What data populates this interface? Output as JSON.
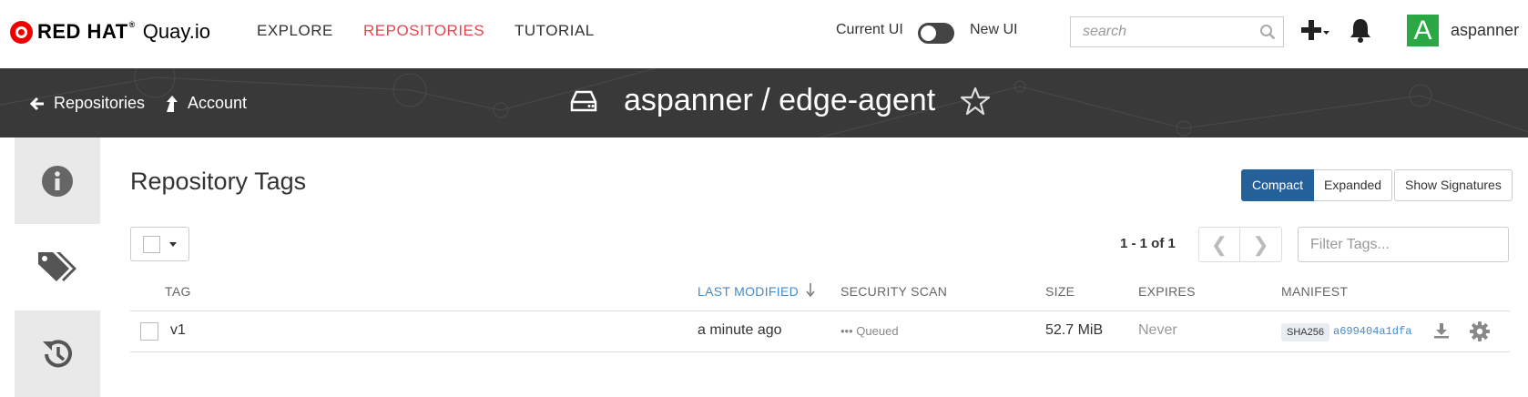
{
  "brand": {
    "red_hat": "RED HAT",
    "reg": "®",
    "quay": "Quay.io"
  },
  "nav": {
    "explore": "EXPLORE",
    "repositories": "REPOSITORIES",
    "tutorial": "TUTORIAL"
  },
  "ui_toggle": {
    "current": "Current UI",
    "new": "New UI",
    "state": "current"
  },
  "search": {
    "placeholder": "search"
  },
  "user": {
    "avatar_letter": "A",
    "name": "aspanner"
  },
  "header": {
    "back_repos": "Repositories",
    "account": "Account",
    "repo_title": "aspanner / edge-agent"
  },
  "main": {
    "title": "Repository Tags",
    "view_buttons": {
      "compact": "Compact",
      "expanded": "Expanded",
      "signatures": "Show Signatures"
    },
    "page_count": "1 - 1 of 1",
    "filter_placeholder": "Filter Tags..."
  },
  "table": {
    "headers": {
      "tag": "TAG",
      "last_modified": "LAST MODIFIED",
      "security_scan": "SECURITY SCAN",
      "size": "SIZE",
      "expires": "EXPIRES",
      "manifest": "MANIFEST"
    },
    "rows": [
      {
        "tag": "v1",
        "last_modified": "a minute ago",
        "security_scan": "Queued",
        "size": "52.7 MiB",
        "expires": "Never",
        "manifest_algo": "SHA256",
        "manifest_digest": "a699404a1dfa"
      }
    ]
  },
  "colors": {
    "accent_red": "#e2474f",
    "primary_blue": "#24619b",
    "link_blue": "#428bca",
    "header_bg": "#393939",
    "avatar_green": "#2aa843"
  }
}
